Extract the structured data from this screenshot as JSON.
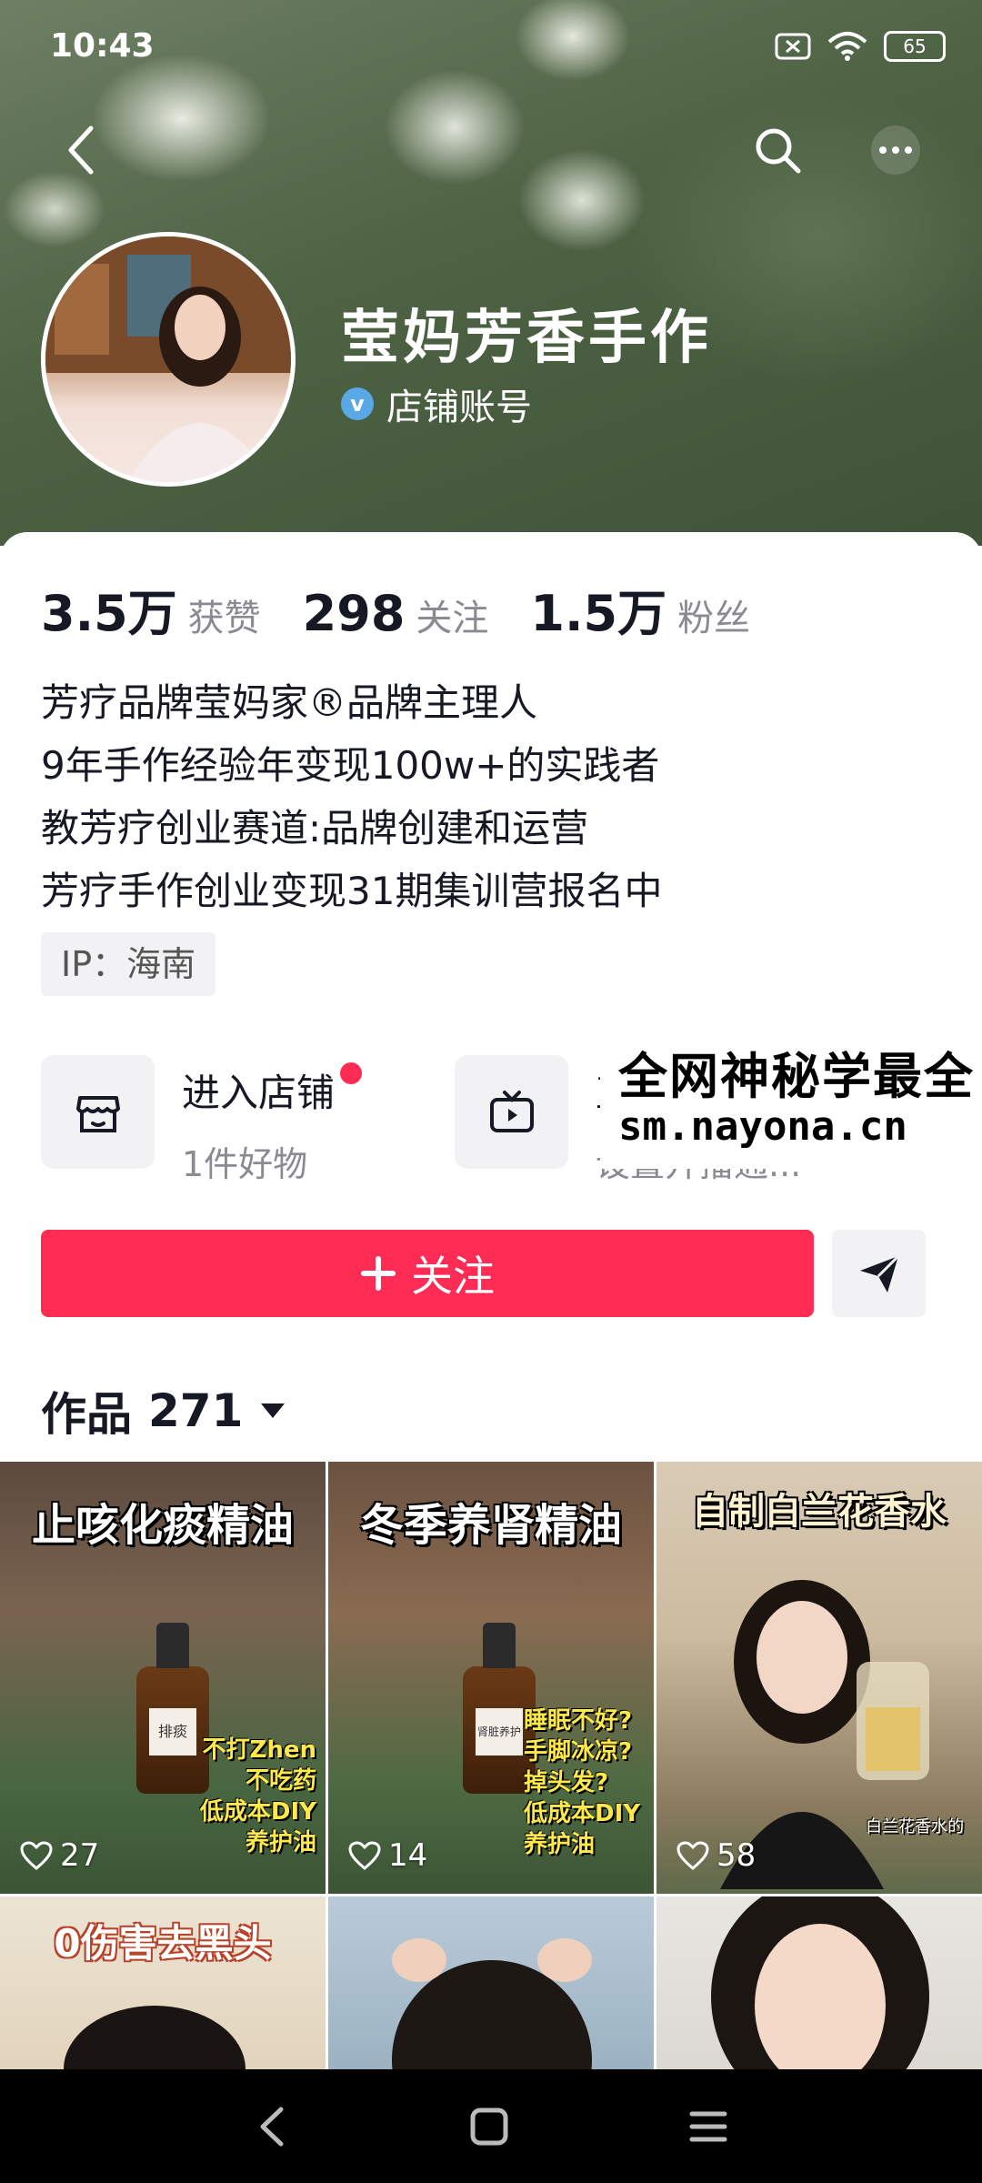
{
  "status_bar": {
    "time": "10:43",
    "battery": "65"
  },
  "profile": {
    "name": "莹妈芳香手作",
    "account_type": "店铺账号"
  },
  "stats": [
    {
      "value": "3.5万",
      "label": "获赞"
    },
    {
      "value": "298",
      "label": "关注"
    },
    {
      "value": "1.5万",
      "label": "粉丝"
    }
  ],
  "bio": [
    "芳疗品牌莹妈家®品牌主理人",
    "9年手作经验年变现100w+的实践者",
    "教芳疗创业赛道:品牌创建和运营",
    "芳疗手作创业变现31期集训营报名中"
  ],
  "ip": "IP：海南",
  "features": {
    "shop": {
      "title": "进入店铺",
      "subtitle": "1件好物"
    },
    "live": {
      "title": "直",
      "subtitle": "设置开播通..."
    }
  },
  "watermark": {
    "line1": "全网神秘学最全",
    "line2": "sm.nayona.cn"
  },
  "follow_button": "关注",
  "works": {
    "label": "作品",
    "count": "271"
  },
  "videos": [
    {
      "title": "止咳化痰精油",
      "label": "排痰",
      "caption": "不打Zhen\n不吃药\n低成本DIY养护油",
      "likes": "27"
    },
    {
      "title": "冬季养肾精油",
      "label": "肾脏养护",
      "caption": "睡眠不好?\n手脚冰凉?\n掉头发?\n低成本DIY养护油",
      "likes": "14"
    },
    {
      "title": "自制白兰花香水",
      "label": "",
      "caption": "白兰花香水的",
      "likes": "58"
    },
    {
      "title": "0伤害去黑头",
      "label": "",
      "caption": "",
      "likes": ""
    },
    {
      "title": "",
      "label": "",
      "caption": "",
      "likes": ""
    },
    {
      "title": "",
      "label": "",
      "caption": "",
      "likes": ""
    }
  ],
  "colors": {
    "accent": "#fe2c55",
    "verify": "#5aa8e6"
  }
}
